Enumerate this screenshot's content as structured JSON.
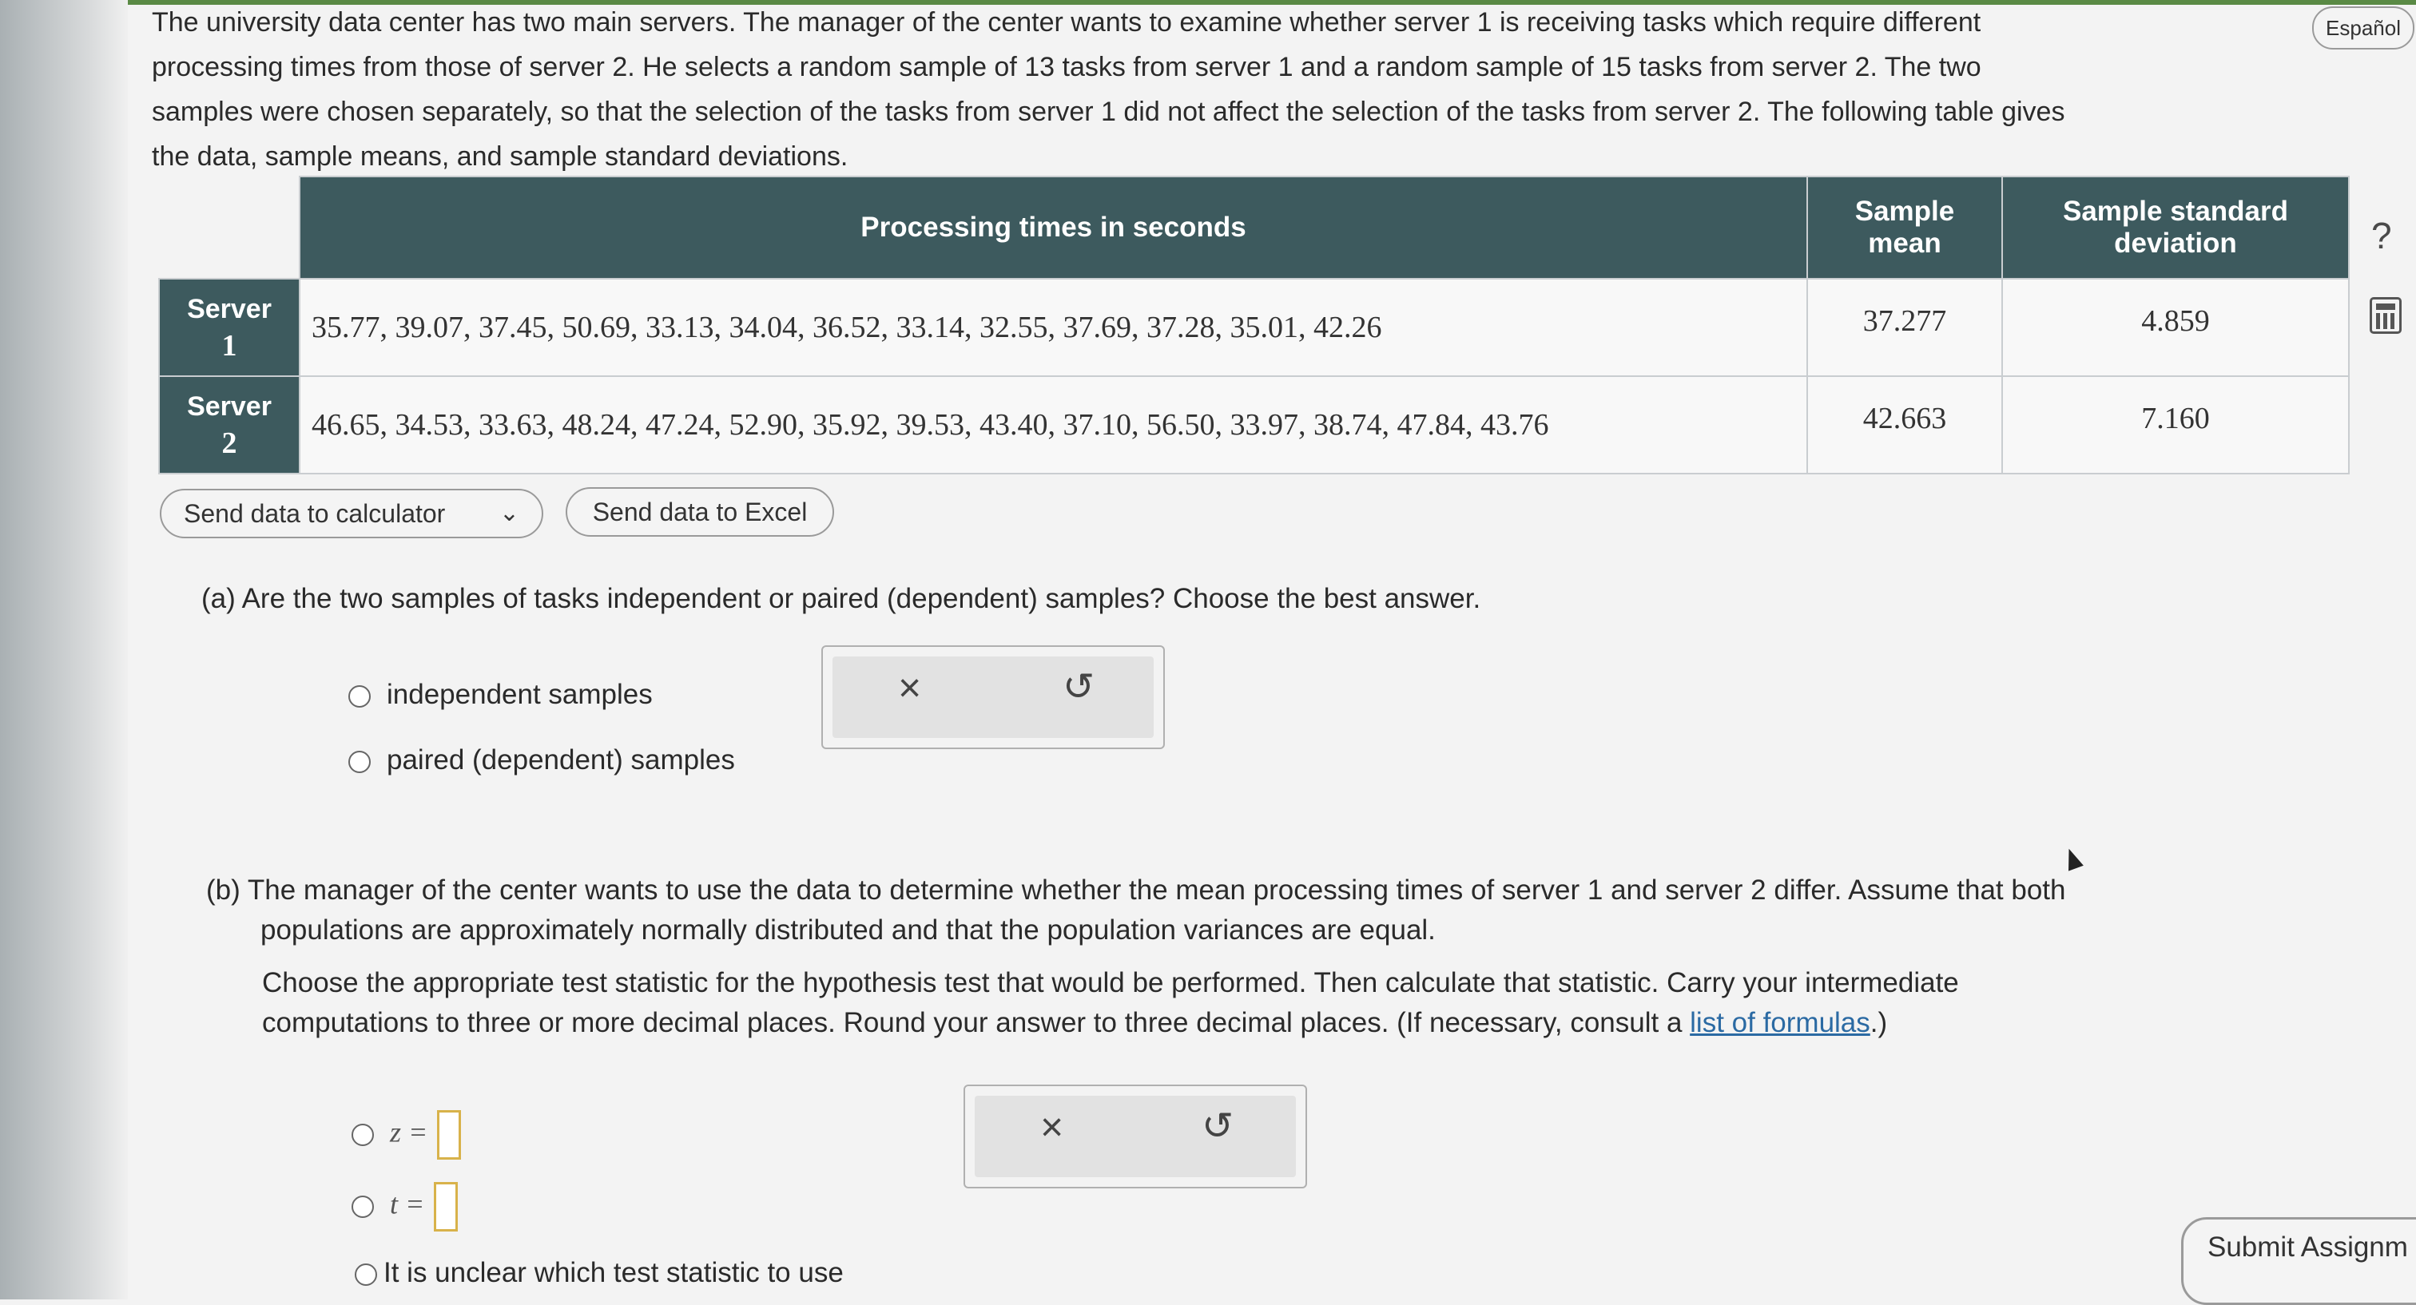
{
  "intro": {
    "line1": "The university data center has two main servers. The manager of the center wants to examine whether server 1 is receiving tasks which require different",
    "line2": "processing times from those of server 2. He selects a random sample of 13 tasks from server 1 and a random sample of 15 tasks from server 2. The two",
    "line3": "samples were chosen separately, so that the selection of the tasks from server 1 did not affect the selection of the tasks from server 2. The following table gives",
    "line4": "the data, sample means, and sample standard deviations."
  },
  "header_controls": {
    "language_label": "Español",
    "help_icon": "question-mark-icon",
    "calculator_icon": "calculator-icon"
  },
  "table": {
    "col_processing": "Processing times in seconds",
    "col_mean_l1": "Sample",
    "col_mean_l2": "mean",
    "col_sd_l1": "Sample standard",
    "col_sd_l2": "deviation",
    "rows": [
      {
        "label": "Server",
        "num": "1",
        "values": "35.77, 39.07, 37.45, 50.69, 33.13, 34.04, 36.52, 33.14, 32.55, 37.69, 37.28, 35.01, 42.26",
        "mean": "37.277",
        "sd": "4.859"
      },
      {
        "label": "Server",
        "num": "2",
        "values": "46.65, 34.53, 33.63, 48.24, 47.24, 52.90, 35.92, 39.53, 43.40, 37.10, 56.50, 33.97, 38.74, 47.84, 43.76",
        "mean": "42.663",
        "sd": "7.160"
      }
    ]
  },
  "buttons": {
    "send_calculator": "Send data to calculator",
    "send_excel": "Send data to Excel",
    "chevron": "chevron-down-icon"
  },
  "part_a": {
    "question": "(a) Are the two samples of tasks independent or paired (dependent) samples? Choose the best answer.",
    "option1": "independent samples",
    "option2": "paired (dependent) samples"
  },
  "tools": {
    "clear": "×",
    "undo": "↺"
  },
  "part_b": {
    "label": "(b)",
    "line1": "The manager of the center wants to use the data to determine whether the mean processing times of server 1 and server 2 differ. Assume that both",
    "line2": "populations are approximately normally distributed and that the population variances are equal.",
    "line3": "Choose the appropriate test statistic for the hypothesis test that would be performed. Then calculate that statistic. Carry your intermediate",
    "line4_pre": "computations to three or more decimal places. Round your answer to three decimal places. (If necessary, consult a ",
    "link": "list of formulas",
    "line4_post": ".)",
    "opt_z": "z =",
    "opt_t": "t =",
    "opt_unclear": "It is unclear which test statistic to use"
  },
  "submit_label": "Submit Assignm"
}
